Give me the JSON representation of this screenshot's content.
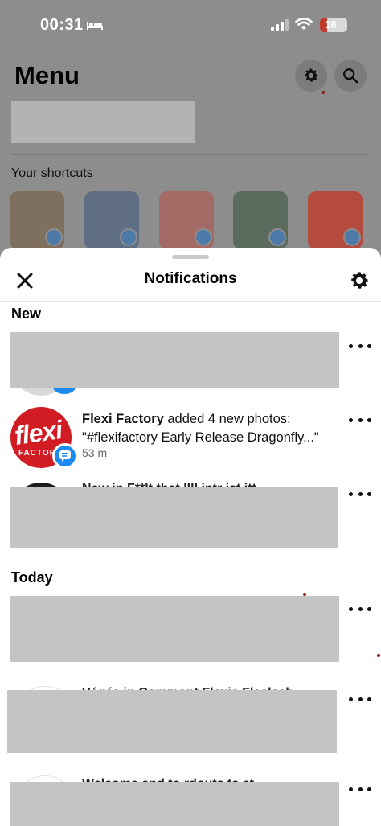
{
  "status_bar": {
    "time": "00:31",
    "battery": "16"
  },
  "menu": {
    "title": "Menu",
    "shortcuts_label": "Your shortcuts",
    "shortcuts": [
      {
        "thumb_color": "#7f6f5f"
      },
      {
        "thumb_color": "#5f6e83"
      },
      {
        "thumb_color": "#a36a66"
      },
      {
        "thumb_color": "#5b6b5e"
      },
      {
        "thumb_color": "#b54a3f"
      }
    ]
  },
  "notifications": {
    "title": "Notifications",
    "sections": {
      "new": "New",
      "today": "Today"
    },
    "items": [
      {
        "actor": "Flexi Factory",
        "message": " added 4 new photos: \"#flexifactory Early Release Dragonfly...\"",
        "time": "53 m",
        "avatar_text": "flexi",
        "avatar_sub": "FACTORY"
      }
    ],
    "partial_lines": [
      "New in F**lt that  Illl  intr  ist itt",
      "Végés in Commont  Flexis Flaslesh",
      "Welcome and to  rdouts     ts  ct"
    ]
  },
  "colors": {
    "accent": "#1b8bf2",
    "brand_red": "#d21c24",
    "redaction": "#c4c4c4",
    "overlay": "#8d8d8d"
  }
}
